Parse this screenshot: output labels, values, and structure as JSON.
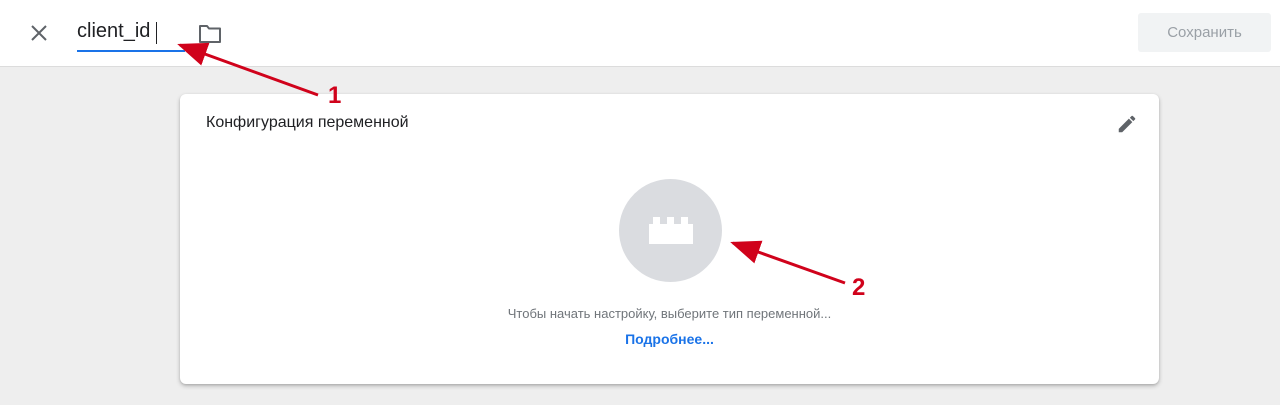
{
  "header": {
    "variable_name": "client_id",
    "save_label": "Сохранить",
    "close_icon": "close-icon",
    "folder_icon": "folder-icon"
  },
  "card": {
    "title": "Конфигурация переменной",
    "edit_icon": "pencil-icon",
    "type_icon": "lego-brick-icon",
    "hint": "Чтобы начать настройку, выберите тип переменной...",
    "learn_more": "Подробнее..."
  },
  "annotations": {
    "marker_1": "1",
    "marker_2": "2",
    "color": "#d0021b"
  },
  "colors": {
    "accent": "#1a73e8",
    "annotation": "#d0021b"
  }
}
